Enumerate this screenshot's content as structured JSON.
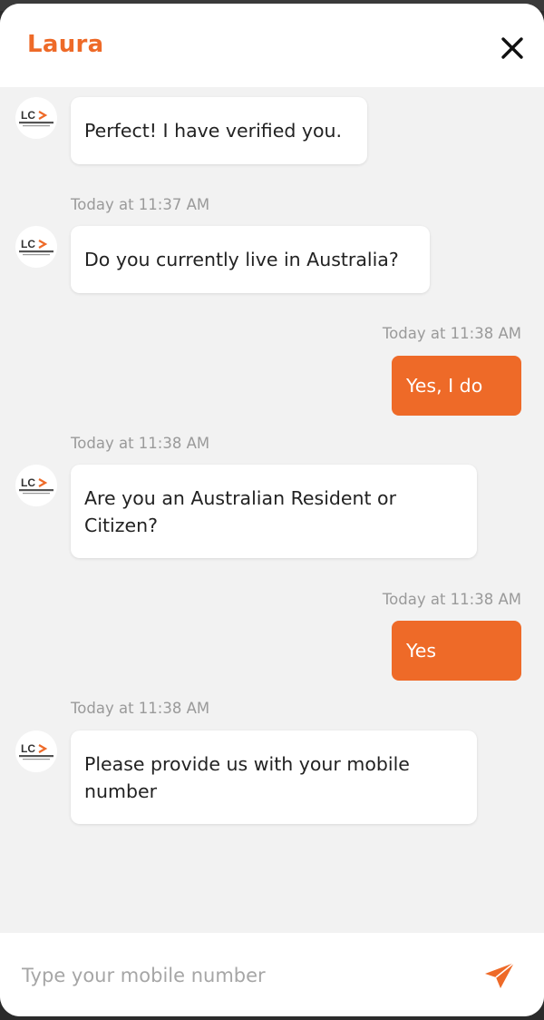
{
  "header": {
    "title": "Laura",
    "close_icon": "close-icon"
  },
  "brand": {
    "accent_color": "#ee6a28",
    "logo_letters": "LC",
    "logo_text": "LABOUR CONNECT"
  },
  "messages": [
    {
      "from": "bot",
      "text": "Perfect! I have verified you."
    },
    {
      "from": "bot",
      "timestamp": "Today at 11:37 AM",
      "text": "Do you currently live in Australia?"
    },
    {
      "from": "user",
      "timestamp": "Today at 11:38 AM",
      "text": "Yes, I do"
    },
    {
      "from": "bot",
      "timestamp": "Today at 11:38 AM",
      "text": "Are you an Australian Resident or Citizen?"
    },
    {
      "from": "user",
      "timestamp": "Today at 11:38 AM",
      "text": "Yes"
    },
    {
      "from": "bot",
      "timestamp": "Today at 11:38 AM",
      "text": "Please provide us with your mobile number"
    }
  ],
  "composer": {
    "placeholder": "Type your mobile number",
    "send_icon": "send-icon"
  }
}
